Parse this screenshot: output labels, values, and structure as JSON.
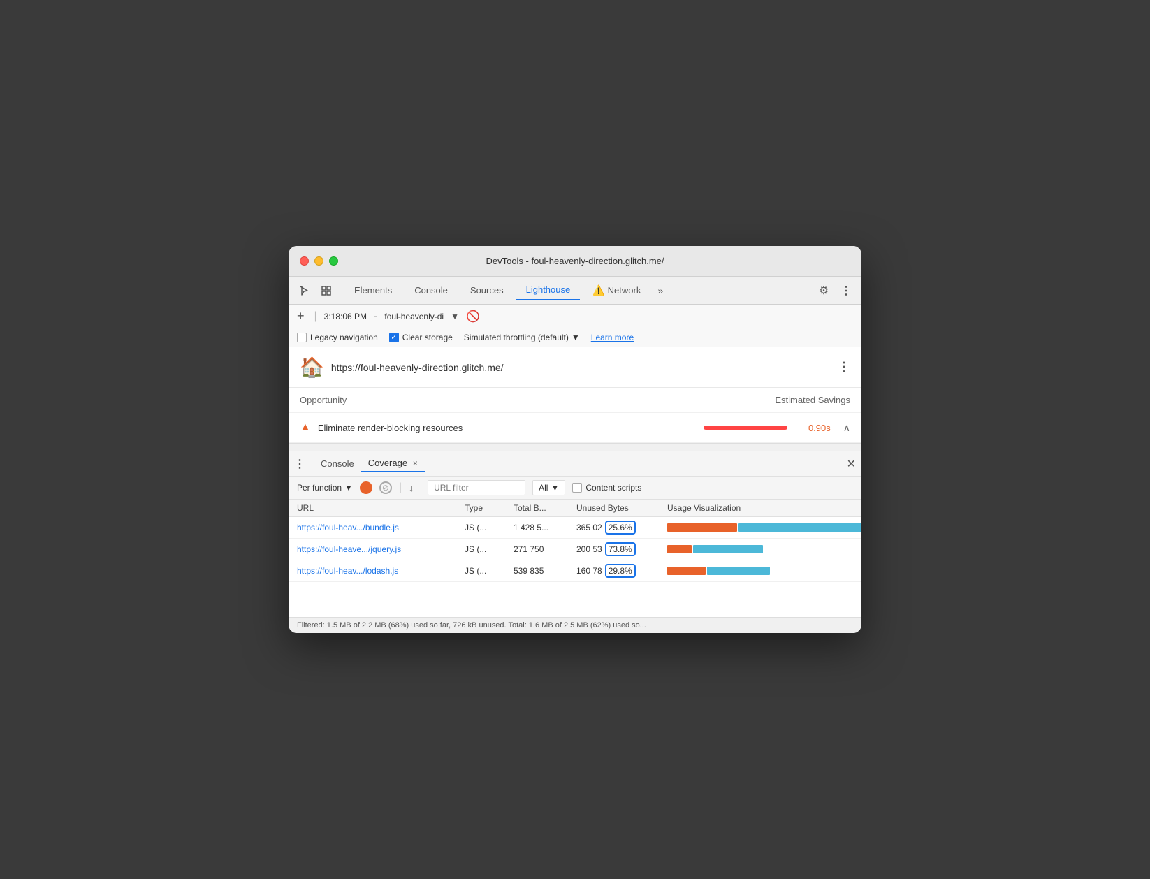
{
  "window": {
    "title": "DevTools - foul-heavenly-direction.glitch.me/"
  },
  "tabs": [
    {
      "id": "elements",
      "label": "Elements",
      "active": false
    },
    {
      "id": "console",
      "label": "Console",
      "active": false
    },
    {
      "id": "sources",
      "label": "Sources",
      "active": false
    },
    {
      "id": "lighthouse",
      "label": "Lighthouse",
      "active": true
    },
    {
      "id": "network",
      "label": "Network",
      "active": false,
      "warning": true
    }
  ],
  "toolbar": {
    "time": "3:18:06 PM",
    "url_short": "foul-heavenly-di",
    "url_full": "foul-heavenly-direction.glitch.me/"
  },
  "options": {
    "legacy_nav_label": "Legacy navigation",
    "legacy_nav_checked": false,
    "clear_storage_label": "Clear storage",
    "clear_storage_checked": true,
    "throttling_label": "Simulated throttling (default)",
    "learn_more_label": "Learn more"
  },
  "lighthouse_header": {
    "url": "https://foul-heavenly-direction.glitch.me/"
  },
  "opportunity": {
    "section_label": "Opportunity",
    "savings_label": "Estimated Savings",
    "row": {
      "title": "Eliminate render-blocking resources",
      "savings": "0.90s"
    }
  },
  "coverage": {
    "tabs": [
      {
        "id": "console",
        "label": "Console",
        "active": false
      },
      {
        "id": "coverage",
        "label": "Coverage",
        "active": true
      }
    ],
    "toolbar": {
      "per_function_label": "Per function",
      "url_filter_placeholder": "URL filter",
      "all_label": "All",
      "content_scripts_label": "Content scripts"
    },
    "table": {
      "headers": [
        "URL",
        "Type",
        "Total B...",
        "Unused Bytes",
        "Usage Visualization"
      ],
      "rows": [
        {
          "url": "https://foul-heav.../bundle.js",
          "type": "JS (...",
          "total": "1 428 5...",
          "unused_raw": "365 02",
          "unused_percent": "25.6%",
          "used_pct": 74,
          "unused_pct": 26
        },
        {
          "url": "https://foul-heave.../jquery.js",
          "type": "JS (...",
          "total": "271 750",
          "unused_raw": "200 53",
          "unused_percent": "73.8%",
          "used_pct": 26,
          "unused_pct": 74
        },
        {
          "url": "https://foul-heav.../lodash.js",
          "type": "JS (...",
          "total": "539 835",
          "unused_raw": "160 78",
          "unused_percent": "29.8%",
          "used_pct": 70,
          "unused_pct": 30
        }
      ]
    },
    "status_bar": "Filtered: 1.5 MB of 2.2 MB (68%) used so far, 726 kB unused. Total: 1.6 MB of 2.5 MB (62%) used so..."
  }
}
